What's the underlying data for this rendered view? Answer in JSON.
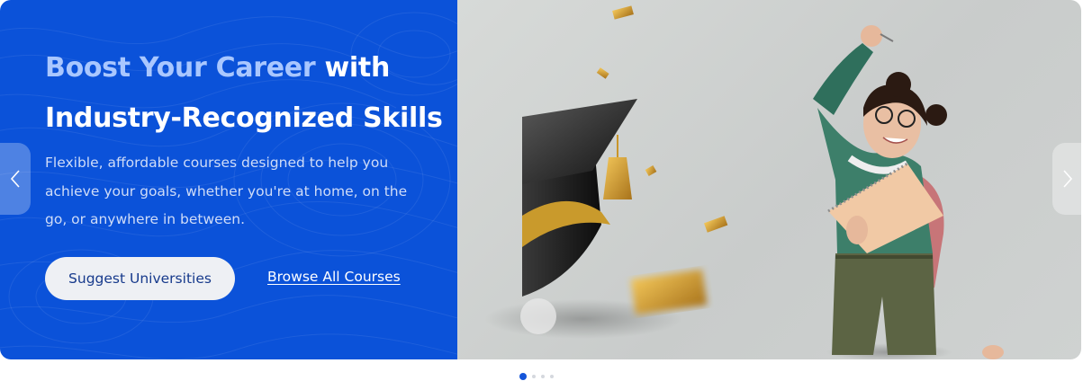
{
  "hero": {
    "headline_highlight": "Boost Your Career",
    "headline_rest_1": " with",
    "headline_rest_2": "Industry-Recognized Skills",
    "description": "Flexible, affordable courses designed to help you achieve your goals, whether you're at home, on the go, or anywhere in between.",
    "primary_button": "Suggest Universities",
    "secondary_link": "Browse All Courses"
  },
  "carousel": {
    "prev_icon": "chevron-left-icon",
    "next_icon": "chevron-right-icon",
    "slide_count": 4,
    "active_index": 0
  },
  "colors": {
    "panel_blue": "#0b52d9",
    "headline_highlight": "#a9c7ff",
    "button_text": "#173a8c",
    "active_dot": "#1455d9"
  }
}
